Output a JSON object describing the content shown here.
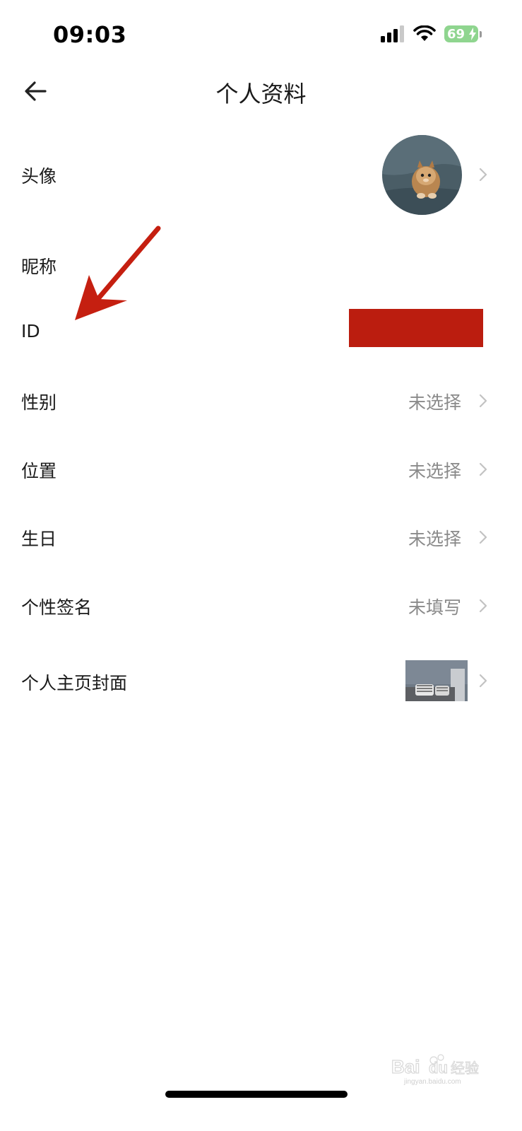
{
  "status_bar": {
    "time": "09:03",
    "battery_level": "69",
    "icons": [
      "signal-icon",
      "wifi-icon",
      "battery-icon",
      "charging-bolt-icon"
    ]
  },
  "nav": {
    "back_icon": "back-arrow-icon",
    "title": "个人资料"
  },
  "rows": {
    "avatar": {
      "label": "头像"
    },
    "nickname": {
      "label": "昵称"
    },
    "id": {
      "label": "ID"
    },
    "gender": {
      "label": "性别",
      "value": "未选择"
    },
    "location": {
      "label": "位置",
      "value": "未选择"
    },
    "birthday": {
      "label": "生日",
      "value": "未选择"
    },
    "signature": {
      "label": "个性签名",
      "value": "未填写"
    },
    "cover": {
      "label": "个人主页封面"
    }
  },
  "annotation": {
    "arrow_color": "#c51f10",
    "redaction_color": "#bb1d0f"
  },
  "watermark": {
    "text": "Bai du 经验",
    "sub": "jingyan.baidu.com"
  },
  "colors": {
    "value_text": "#8a8a8a",
    "chevron": "#c2c2c2",
    "battery": "#8fd58f"
  }
}
